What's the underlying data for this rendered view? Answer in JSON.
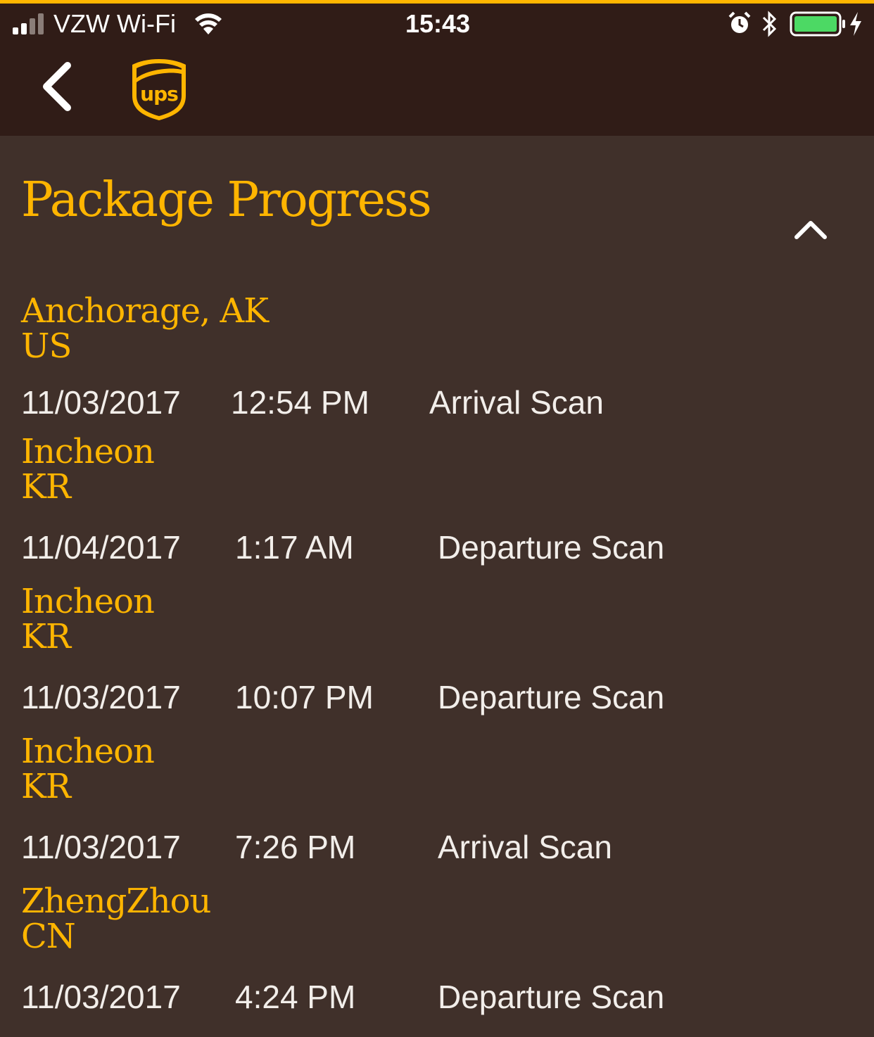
{
  "status": {
    "carrier": "VZW Wi-Fi",
    "time": "15:43",
    "battery_color": "#4cd964"
  },
  "nav": {
    "back_icon": "chevron-left-icon",
    "logo": "ups"
  },
  "section": {
    "title": "Package Progress",
    "collapse_icon": "chevron-up-icon"
  },
  "events": [
    {
      "city": "Anchorage, AK",
      "country": "US",
      "date": "11/03/2017",
      "time": "12:54 PM",
      "activity": "Arrival Scan"
    },
    {
      "city": "Incheon",
      "country": "KR",
      "date": "11/04/2017",
      "time": "1:17 AM",
      "activity": "Departure Scan"
    },
    {
      "city": "Incheon",
      "country": "KR",
      "date": "11/03/2017",
      "time": "10:07 PM",
      "activity": "Departure Scan"
    },
    {
      "city": "Incheon",
      "country": "KR",
      "date": "11/03/2017",
      "time": "7:26 PM",
      "activity": "Arrival Scan"
    },
    {
      "city": "ZhengZhou",
      "country": "CN",
      "date": "11/03/2017",
      "time": "4:24 PM",
      "activity": "Departure Scan"
    }
  ],
  "colors": {
    "brand_gold": "#ffb500",
    "header_brown": "#301c17",
    "background_brown": "#40302a"
  }
}
